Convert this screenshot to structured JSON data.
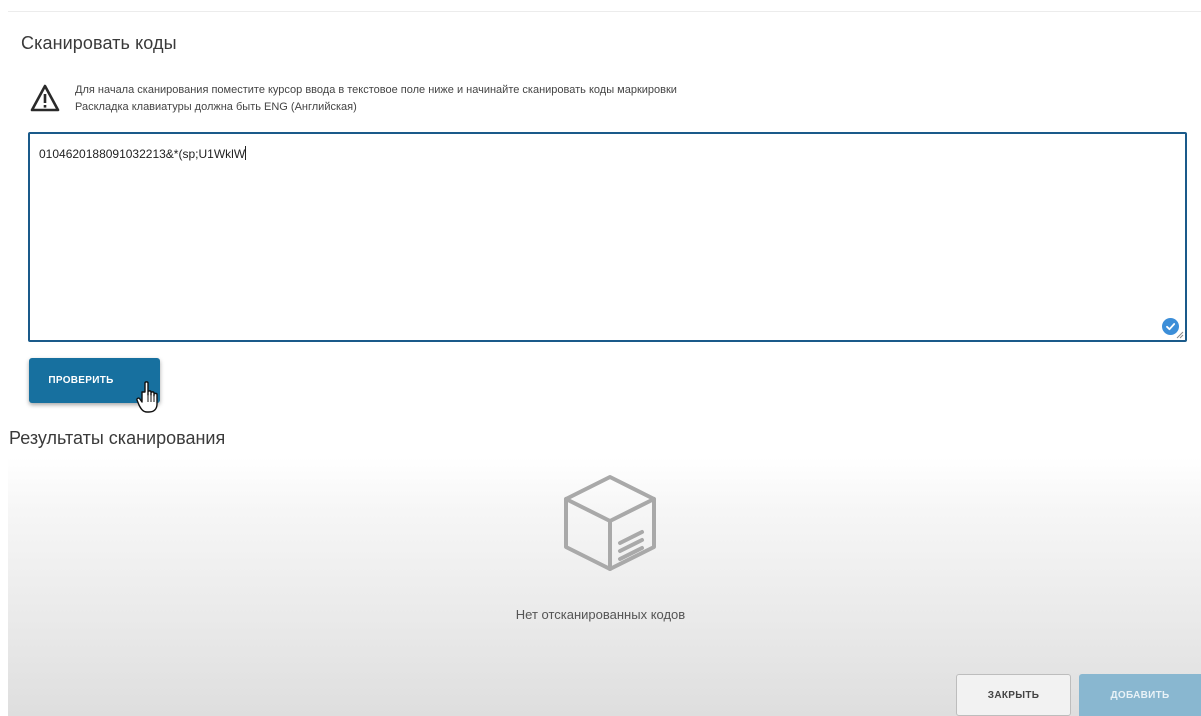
{
  "dialog": {
    "title": "Сканировать коды"
  },
  "notice": {
    "icon": "warning-icon",
    "line1": "Для начала сканирования поместите курсор ввода в текстовое поле ниже и начинайте сканировать коды маркировки",
    "line2": "Раскладка клавиатуры должна быть ENG (Английская)"
  },
  "scan_input": {
    "value": "0104620188091032213&*(sp;U1WklW",
    "status_icon": "check-circle-icon"
  },
  "check_button": {
    "label": "ПРОВЕРИТЬ"
  },
  "results": {
    "title": "Результаты сканирования",
    "empty_icon": "empty-box-icon",
    "empty_text": "Нет отсканированных кодов"
  },
  "footer": {
    "close_label": "ЗАКРЫТЬ",
    "add_label": "ДОБАВИТЬ"
  },
  "colors": {
    "primary": "#17709f",
    "primary_disabled": "#89b7d0",
    "input_border": "#1a5a8a",
    "check_badge": "#3c8ed8"
  }
}
